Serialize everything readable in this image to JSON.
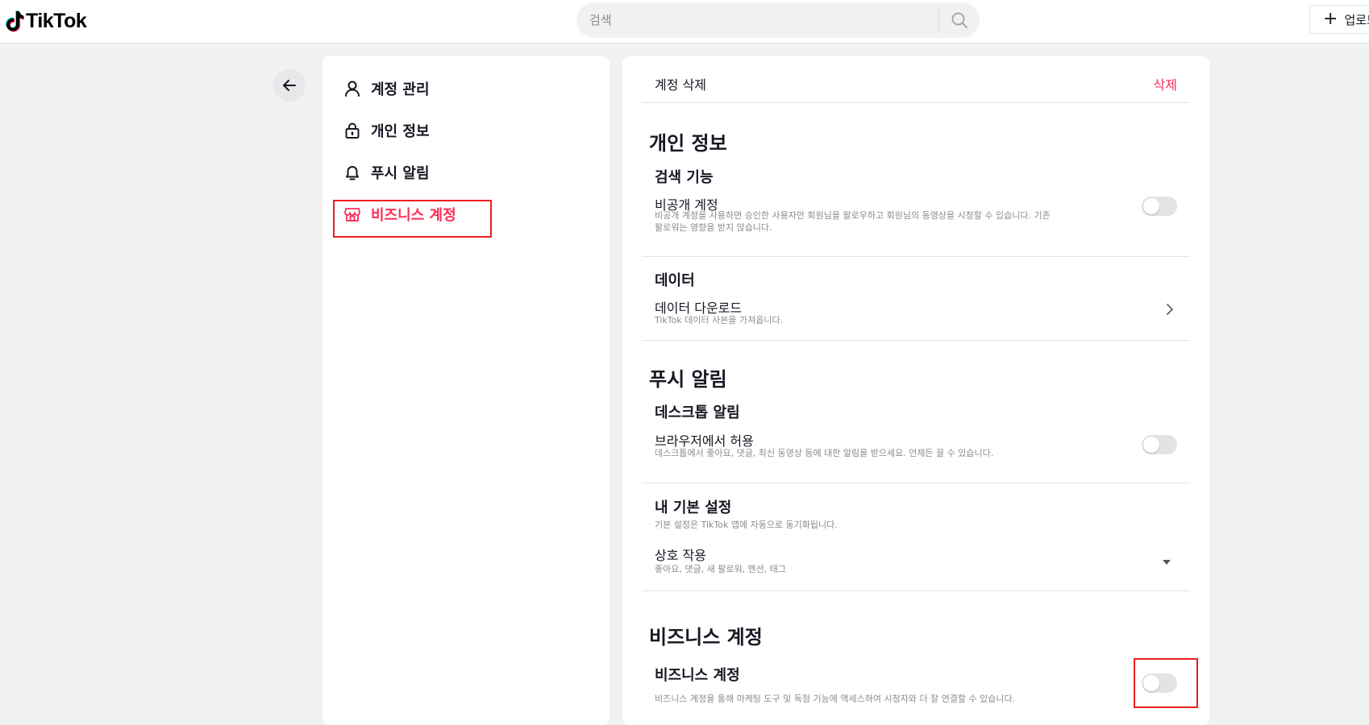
{
  "header": {
    "logo_text": "TikTok",
    "search_placeholder": "검색",
    "upload_label": "업로드"
  },
  "sidebar": {
    "items": [
      {
        "label": "계정 관리",
        "icon": "person-icon",
        "active": false
      },
      {
        "label": "개인 정보",
        "icon": "lock-icon",
        "active": false
      },
      {
        "label": "푸시 알림",
        "icon": "bell-icon",
        "active": false
      },
      {
        "label": "비즈니스 계정",
        "icon": "store-icon",
        "active": true
      }
    ]
  },
  "content": {
    "account": {
      "delete_label": "계정 삭제",
      "delete_action": "삭제"
    },
    "privacy": {
      "title": "개인 정보",
      "discoverability": {
        "title": "검색 기능",
        "private_account": {
          "label": "비공개 계정",
          "desc_line1": "비공개 계정을 사용하면 승인한 사용자만 회원님을 팔로우하고 회원님의 동영상을 시청할 수 있습니다. 기존",
          "desc_line2": "팔로워는 영향을 받지 않습니다.",
          "enabled": false
        }
      },
      "data": {
        "title": "데이터",
        "download": {
          "label": "데이터 다운로드",
          "desc": "TikTok 데이터 사본을 가져옵니다."
        }
      }
    },
    "push": {
      "title": "푸시 알림",
      "desktop": {
        "title": "데스크톱 알림",
        "browser": {
          "label": "브라우저에서 허용",
          "desc": "데스크톱에서 좋아요, 댓글, 최신 동영상 등에 대한 알림을 받으세요. 언제든 끌 수 있습니다.",
          "enabled": false
        }
      },
      "preferences": {
        "title": "내 기본 설정",
        "desc": "기본 설정은 TikTok 앱에 자동으로 동기화됩니다.",
        "interactions": {
          "label": "상호 작용",
          "desc": "좋아요, 댓글, 새 팔로워, 멘션, 태그"
        }
      }
    },
    "business": {
      "title": "비즈니스 계정",
      "toggle_label": "비즈니스 계정",
      "desc": "비즈니스 계정을 통해 마케팅 도구 및 독점 기능에 액세스하여 시청자와 더 잘 연결할 수 있습니다.",
      "enabled": false
    }
  },
  "colors": {
    "accent": "#fe2c55",
    "highlight": "#ee1d23",
    "background": "#f1f1f2"
  }
}
